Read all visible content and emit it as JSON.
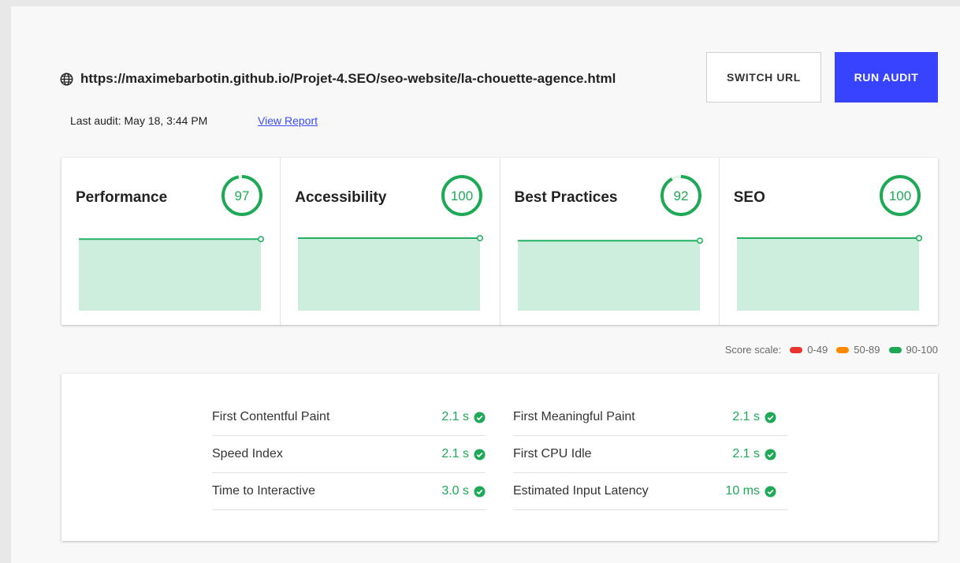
{
  "header": {
    "url": "https://maximebarbotin.github.io/Projet-4.SEO/seo-website/la-chouette-agence.html",
    "switch_label": "SWITCH URL",
    "run_label": "RUN AUDIT",
    "last_audit": "Last audit: May 18, 3:44 PM",
    "view_report": "View Report"
  },
  "scores": [
    {
      "title": "Performance",
      "score": "97",
      "value": 97
    },
    {
      "title": "Accessibility",
      "score": "100",
      "value": 100
    },
    {
      "title": "Best Practices",
      "score": "92",
      "value": 92
    },
    {
      "title": "SEO",
      "score": "100",
      "value": 100
    }
  ],
  "scale": {
    "label": "Score scale:",
    "ranges": [
      {
        "label": "0-49",
        "color": "#e8342c"
      },
      {
        "label": "50-89",
        "color": "#ff8a00"
      },
      {
        "label": "90-100",
        "color": "#1ea957"
      }
    ]
  },
  "metrics": {
    "left": [
      {
        "label": "First Contentful Paint",
        "value": "2.1 s"
      },
      {
        "label": "Speed Index",
        "value": "2.1 s"
      },
      {
        "label": "Time to Interactive",
        "value": "3.0 s"
      }
    ],
    "right": [
      {
        "label": "First Meaningful Paint",
        "value": "2.1 s"
      },
      {
        "label": "First CPU Idle",
        "value": "2.1 s"
      },
      {
        "label": "Estimated Input Latency",
        "value": "10 ms"
      }
    ]
  },
  "colors": {
    "accent": "#3843ff",
    "pass": "#1ea957",
    "spark_fill": "#cdeedd",
    "spark_line": "#23b062"
  }
}
